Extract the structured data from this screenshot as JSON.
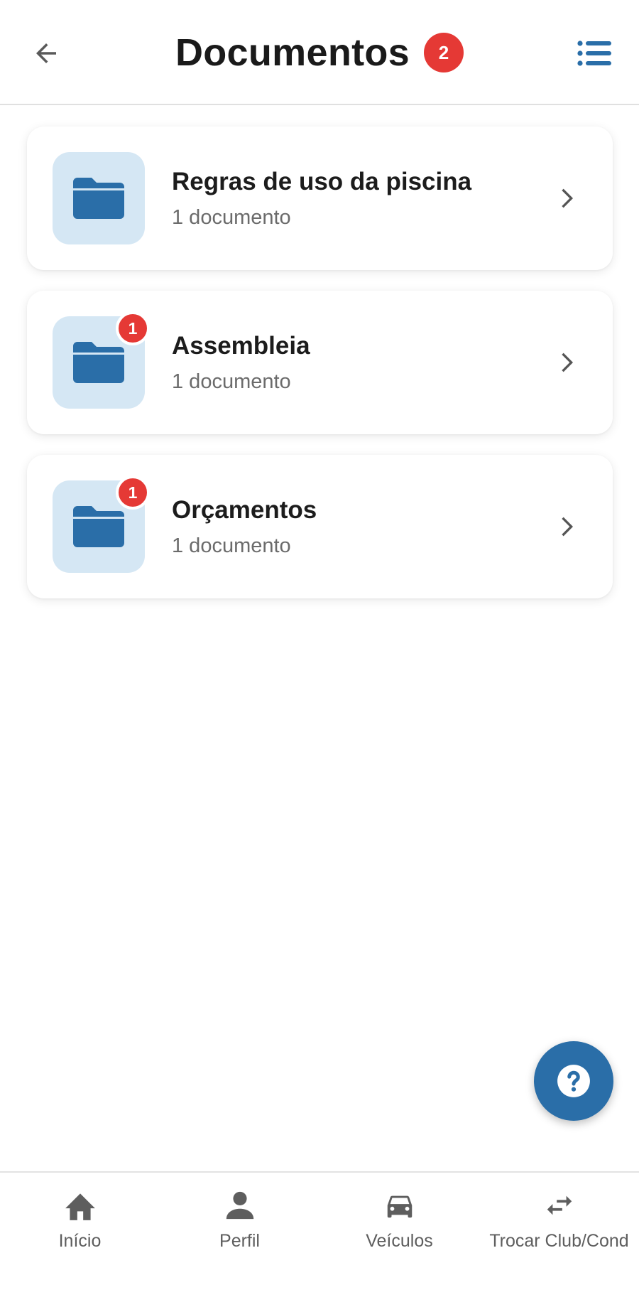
{
  "header": {
    "title": "Documentos",
    "badge": "2",
    "back_icon": "arrow-left-icon",
    "menu_icon": "list-icon"
  },
  "folders": [
    {
      "title": "Regras de uso da piscina",
      "subtitle": "1 documento",
      "badge": ""
    },
    {
      "title": "Assembleia",
      "subtitle": "1 documento",
      "badge": "1"
    },
    {
      "title": "Orçamentos",
      "subtitle": "1 documento",
      "badge": "1"
    }
  ],
  "fab": {
    "icon": "help-icon"
  },
  "bottom_nav": [
    {
      "label": "Início",
      "icon": "home-icon"
    },
    {
      "label": "Perfil",
      "icon": "person-icon"
    },
    {
      "label": "Veículos",
      "icon": "car-icon"
    },
    {
      "label": "Trocar Club/Cond",
      "icon": "swap-icon"
    }
  ],
  "colors": {
    "accent": "#2a6ea8",
    "badge": "#e53935",
    "folder_tile": "#d5e7f4",
    "icon_gray": "#5e5e5e"
  }
}
